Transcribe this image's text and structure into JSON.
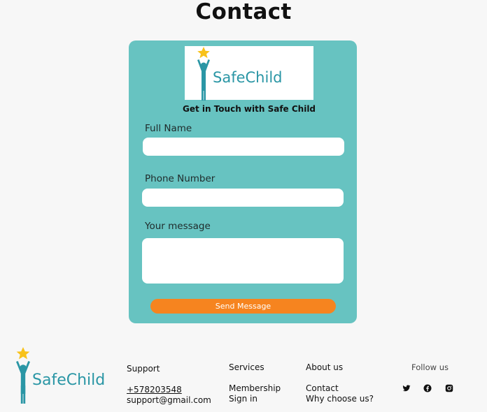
{
  "page": {
    "title": "Contact"
  },
  "brand": {
    "name": "SafeChild"
  },
  "contact_card": {
    "heading": "Get in Touch with Safe Child",
    "fields": {
      "full_name": {
        "label": "Full Name",
        "value": "",
        "placeholder": ""
      },
      "phone": {
        "label": "Phone Number",
        "value": "",
        "placeholder": ""
      },
      "message": {
        "label": "Your message",
        "value": "",
        "placeholder": ""
      }
    },
    "send_label": "Send Message"
  },
  "colors": {
    "card": "#67c3c1",
    "button": "#f6841f",
    "brand_text": "#2a96a5",
    "star": "#f8c21a"
  },
  "footer": {
    "support": {
      "heading": "Support",
      "phone": "+578203548",
      "email": "support@gmail.com"
    },
    "services": {
      "heading": "Services",
      "links": [
        "Membership",
        "Sign in"
      ]
    },
    "about": {
      "heading": "About us",
      "links": [
        "Contact",
        "Why choose us?"
      ]
    },
    "follow": {
      "heading": "Follow us",
      "icons": [
        "twitter-icon",
        "facebook-icon",
        "instagram-icon"
      ]
    }
  }
}
